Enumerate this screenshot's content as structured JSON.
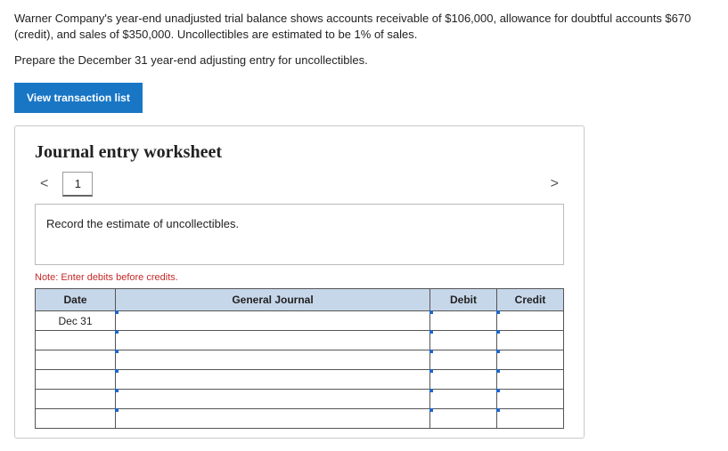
{
  "problem": {
    "line1": "Warner Company's year-end unadjusted trial balance shows accounts receivable of $106,000, allowance for doubtful accounts $670 (credit), and sales of $350,000. Uncollectibles are estimated to be 1% of sales.",
    "line2": "Prepare the December 31 year-end adjusting entry for uncollectibles."
  },
  "buttons": {
    "view_transaction_list": "View transaction list"
  },
  "worksheet": {
    "title": "Journal entry worksheet",
    "prev": "<",
    "next": ">",
    "tabs": [
      "1"
    ],
    "instruction": "Record the estimate of uncollectibles.",
    "note": "Note: Enter debits before credits.",
    "headers": {
      "date": "Date",
      "general_journal": "General Journal",
      "debit": "Debit",
      "credit": "Credit"
    },
    "rows": [
      {
        "date": "Dec 31",
        "gj": "",
        "debit": "",
        "credit": ""
      },
      {
        "date": "",
        "gj": "",
        "debit": "",
        "credit": ""
      },
      {
        "date": "",
        "gj": "",
        "debit": "",
        "credit": ""
      },
      {
        "date": "",
        "gj": "",
        "debit": "",
        "credit": ""
      },
      {
        "date": "",
        "gj": "",
        "debit": "",
        "credit": ""
      },
      {
        "date": "",
        "gj": "",
        "debit": "",
        "credit": ""
      }
    ]
  }
}
